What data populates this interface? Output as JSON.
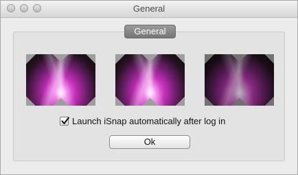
{
  "window": {
    "title": "General"
  },
  "group": {
    "tab_label": "General"
  },
  "previews": [
    {
      "icon": "aurora-wallpaper-preview"
    },
    {
      "icon": "aurora-wallpaper-preview"
    },
    {
      "icon": "aurora-wallpaper-preview-dimmed"
    }
  ],
  "launch_option": {
    "label": "Launch iSnap automatically after log in",
    "checked": true
  },
  "ok_button": {
    "label": "Ok"
  },
  "colors": {
    "tab_bg": "#878787",
    "window_bg": "#ececec",
    "group_bg": "#e3e3e3"
  }
}
